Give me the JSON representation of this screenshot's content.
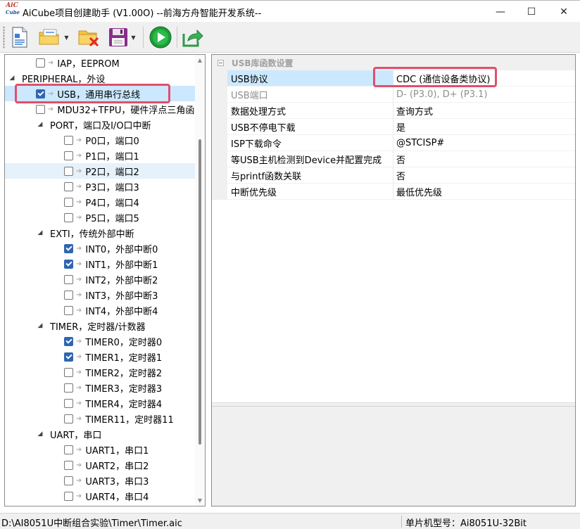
{
  "window": {
    "title": "AiCube项目创建助手 (V1.00O) --前海方舟智能开发系统--",
    "logo_line1": "AiC",
    "logo_line2": "Cube",
    "minimize": "—",
    "maximize": "☐",
    "close": "✕"
  },
  "toolbar": {
    "buttons": [
      "new-document",
      "open-folder",
      "close-project",
      "save",
      "run",
      "export"
    ]
  },
  "tree": {
    "items": [
      {
        "label": "IAP，EEPROM",
        "level": 2,
        "checkbox": true,
        "checked": false
      },
      {
        "label": "PERIPHERAL，外设",
        "level": 0,
        "expander": "◢"
      },
      {
        "label": "USB，通用串行总线",
        "level": 2,
        "checkbox": true,
        "checked": true
      },
      {
        "label": "MDU32+TFPU，硬件浮点三角函",
        "level": 2,
        "checkbox": true,
        "checked": false
      },
      {
        "label": "PORT，端口及I/O口中断",
        "level": 1,
        "expander": "◢"
      },
      {
        "label": "P0口，端口0",
        "level": 3,
        "checkbox": true,
        "checked": false
      },
      {
        "label": "P1口，端口1",
        "level": 3,
        "checkbox": true,
        "checked": false
      },
      {
        "label": "P2口，端口2",
        "level": 3,
        "checkbox": true,
        "checked": false
      },
      {
        "label": "P3口，端口3",
        "level": 3,
        "checkbox": true,
        "checked": false
      },
      {
        "label": "P4口，端口4",
        "level": 3,
        "checkbox": true,
        "checked": false
      },
      {
        "label": "P5口，端口5",
        "level": 3,
        "checkbox": true,
        "checked": false
      },
      {
        "label": "EXTI，传统外部中断",
        "level": 1,
        "expander": "◢"
      },
      {
        "label": "INT0，外部中断0",
        "level": 3,
        "checkbox": true,
        "checked": true
      },
      {
        "label": "INT1，外部中断1",
        "level": 3,
        "checkbox": true,
        "checked": true
      },
      {
        "label": "INT2，外部中断2",
        "level": 3,
        "checkbox": true,
        "checked": false
      },
      {
        "label": "INT3，外部中断3",
        "level": 3,
        "checkbox": true,
        "checked": false
      },
      {
        "label": "INT4，外部中断4",
        "level": 3,
        "checkbox": true,
        "checked": false
      },
      {
        "label": "TIMER，定时器/计数器",
        "level": 1,
        "expander": "◢"
      },
      {
        "label": "TIMER0，定时器0",
        "level": 3,
        "checkbox": true,
        "checked": true
      },
      {
        "label": "TIMER1，定时器1",
        "level": 3,
        "checkbox": true,
        "checked": true
      },
      {
        "label": "TIMER2，定时器2",
        "level": 3,
        "checkbox": true,
        "checked": false
      },
      {
        "label": "TIMER3，定时器3",
        "level": 3,
        "checkbox": true,
        "checked": false
      },
      {
        "label": "TIMER4，定时器4",
        "level": 3,
        "checkbox": true,
        "checked": false
      },
      {
        "label": "TIMER11，定时器11",
        "level": 3,
        "checkbox": true,
        "checked": false
      },
      {
        "label": "UART，串口",
        "level": 1,
        "expander": "◢"
      },
      {
        "label": "UART1，串口1",
        "level": 3,
        "checkbox": true,
        "checked": false
      },
      {
        "label": "UART2，串口2",
        "level": 3,
        "checkbox": true,
        "checked": false
      },
      {
        "label": "UART3，串口3",
        "level": 3,
        "checkbox": true,
        "checked": false
      },
      {
        "label": "UART4，串口4",
        "level": 3,
        "checkbox": true,
        "checked": false
      }
    ],
    "selected_index": 2,
    "hover_index": 7
  },
  "properties": {
    "category": "USB库函数设置",
    "rows": [
      {
        "name": "USB协议",
        "value": "CDC (通信设备类协议)",
        "disabled": false
      },
      {
        "name": "USB端口",
        "value": "D- (P3.0), D+ (P3.1)",
        "disabled": true
      },
      {
        "name": "数据处理方式",
        "value": "查询方式",
        "disabled": false
      },
      {
        "name": "USB不停电下载",
        "value": "是",
        "disabled": false
      },
      {
        "name": "ISP下载命令",
        "value": "@STCISP#",
        "disabled": false
      },
      {
        "name": "等USB主机检测到Device并配置完成",
        "value": "否",
        "disabled": false
      },
      {
        "name": "与printf函数关联",
        "value": "否",
        "disabled": false
      },
      {
        "name": "中断优先级",
        "value": "最低优先级",
        "disabled": false
      }
    ],
    "selected_index": 0
  },
  "status": {
    "path": "D:\\AI8051U中断组合实验\\Timer\\Timer.aic",
    "chip": "单片机型号：Ai8051U-32Bit"
  },
  "colors": {
    "highlight_box": "#e0506a",
    "selection": "#cce8ff",
    "checkbox_on": "#2f66b0"
  }
}
